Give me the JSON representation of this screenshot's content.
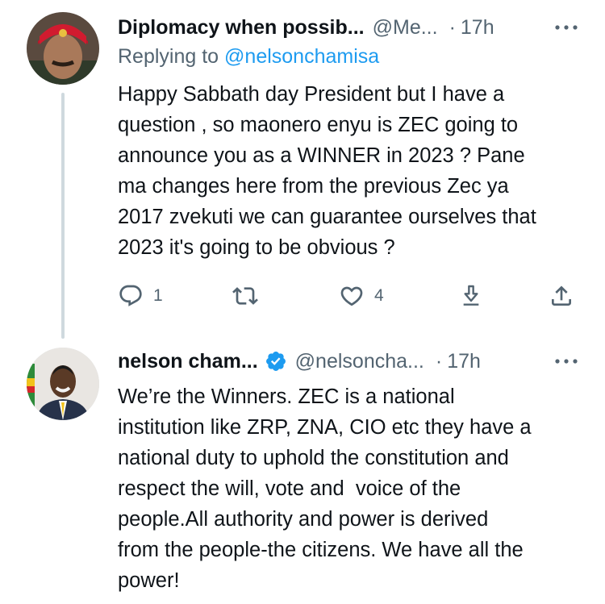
{
  "tweet1": {
    "display_name": "Diplomacy when possib...",
    "handle": "@Me...",
    "separator": "·",
    "time": "17h",
    "replying_prefix": "Replying to",
    "replying_to": "@nelsonchamisa",
    "text": "Happy Sabbath day President but I have a\nquestion , so maonero enyu is ZEC going to\nannounce you as a WINNER in 2023 ? Pane\nma changes here from the previous Zec ya\n2017 zvekuti we can guarantee ourselves that\n2023 it's going to be obvious ?",
    "actions": {
      "reply_count": "1",
      "retweet_count": "",
      "like_count": "4"
    }
  },
  "tweet2": {
    "display_name": "nelson cham...",
    "handle": "@nelsoncha...",
    "separator": "·",
    "time": "17h",
    "verified": true,
    "text": "We’re the Winners. ZEC is a national\ninstitution like ZRP, ZNA, CIO etc they have a\nnational duty to uphold the constitution and\nrespect the will, vote and  voice of the\npeople.All authority and power is derived\nfrom the people-the citizens. We have all the\npower!"
  },
  "colors": {
    "text": "#0f1419",
    "secondary": "#536471",
    "link": "#1d9bf0",
    "thread_line": "#cfd9de",
    "verified_badge": "#1d9bf0"
  },
  "icons": [
    "reply-icon",
    "retweet-icon",
    "like-icon",
    "bookmark-icon",
    "share-icon",
    "more-icon",
    "verified-badge-icon"
  ]
}
